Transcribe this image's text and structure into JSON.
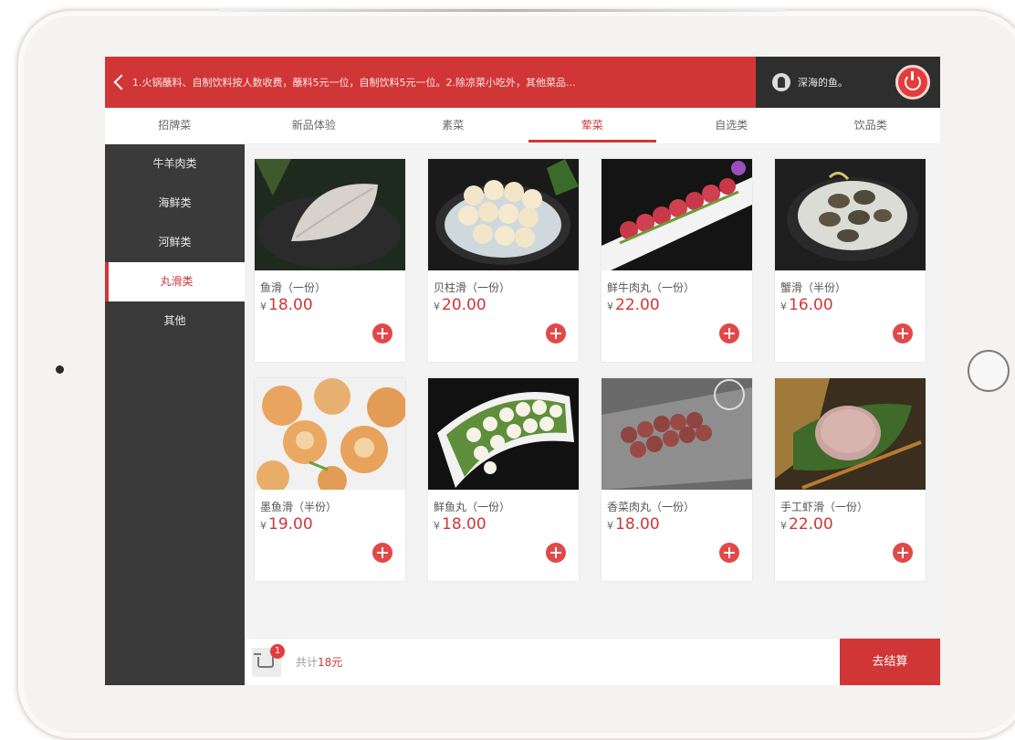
{
  "header": {
    "notice_text": "1.火锅蘸料、自制饮料按人数收费，蘸料5元一位，自制饮料5元一位。2.除凉菜小吃外，其他菜品...",
    "user_name": "深海的鱼。"
  },
  "tabs": [
    {
      "label": "招牌菜",
      "active": false
    },
    {
      "label": "新品体验",
      "active": false
    },
    {
      "label": "素菜",
      "active": false
    },
    {
      "label": "荤菜",
      "active": true
    },
    {
      "label": "自选类",
      "active": false
    },
    {
      "label": "饮品类",
      "active": false
    }
  ],
  "sidebar": {
    "items": [
      {
        "label": "牛羊肉类",
        "active": false
      },
      {
        "label": "海鲜类",
        "active": false
      },
      {
        "label": "河鲜类",
        "active": false
      },
      {
        "label": "丸滑类",
        "active": true
      },
      {
        "label": "其他",
        "active": false
      }
    ]
  },
  "products": [
    {
      "name": "鱼滑（一份）",
      "price": "18.00"
    },
    {
      "name": "贝柱滑（一份）",
      "price": "20.00"
    },
    {
      "name": "鲜牛肉丸（一份）",
      "price": "22.00"
    },
    {
      "name": "蟹滑（半份）",
      "price": "16.00"
    },
    {
      "name": "墨鱼滑（半份）",
      "price": "19.00"
    },
    {
      "name": "鲜鱼丸（一份）",
      "price": "18.00"
    },
    {
      "name": "香菜肉丸（一份）",
      "price": "18.00"
    },
    {
      "name": "手工虾滑（一份）",
      "price": "22.00"
    }
  ],
  "currency_symbol": "¥",
  "cart": {
    "badge_count": "1",
    "total_prefix": "共计",
    "total_amount": "18元",
    "checkout_label": "去结算"
  },
  "colors": {
    "accent": "#d13636",
    "sidebar_bg": "#3a3a3a"
  }
}
